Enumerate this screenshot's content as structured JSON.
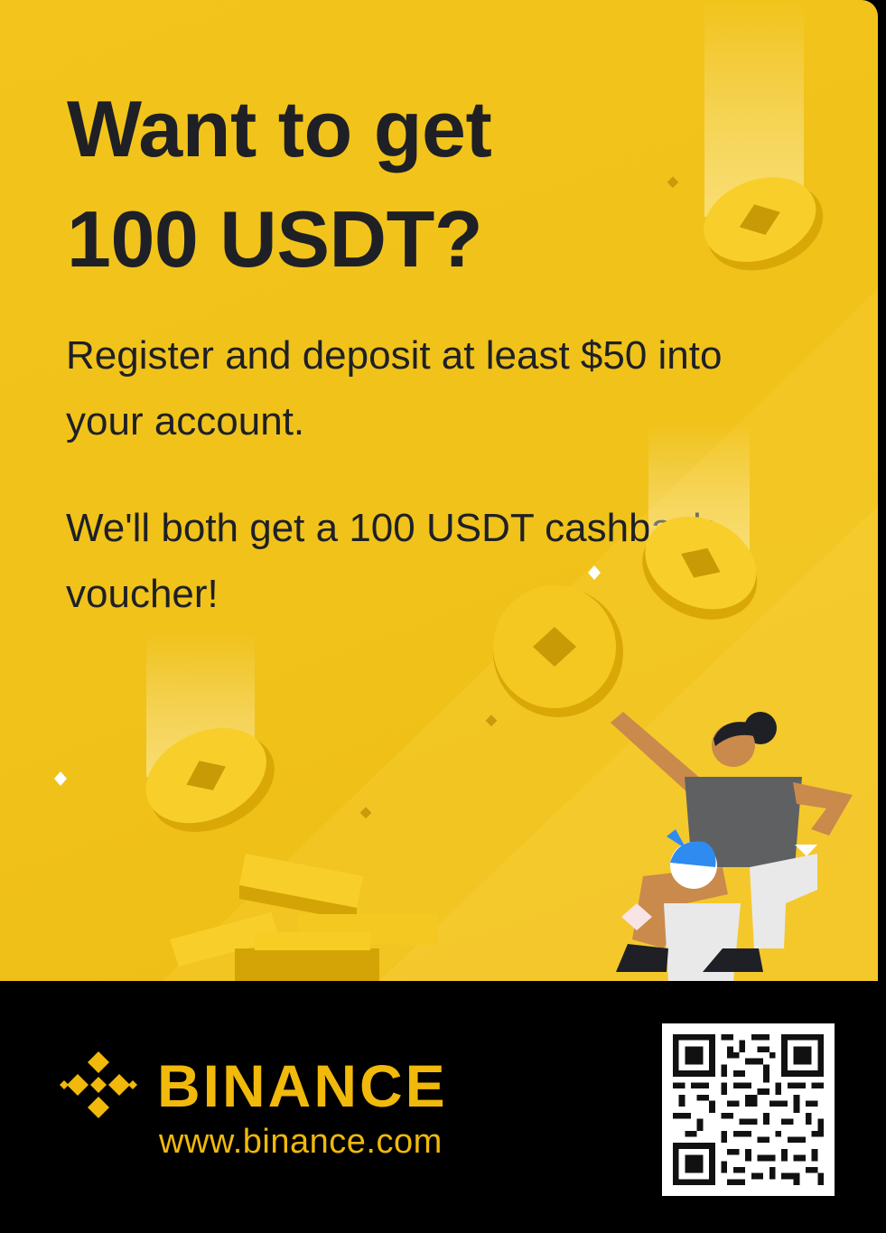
{
  "promo": {
    "headline_line1": "Want to get",
    "headline_line2": "100 USDT?",
    "paragraph1": "Register and deposit at least $50 into your account.",
    "paragraph2": "We'll both get a 100 USDT cashback voucher!"
  },
  "brand": {
    "name": "BINANCE",
    "url": "www.binance.com",
    "logo_icon": "binance-diamond-icon"
  },
  "qr": {
    "icon": "qr-code-icon"
  },
  "colors": {
    "background": "#f0c21a",
    "coin": "#f3c51e",
    "text": "#1e2026",
    "brand": "#f0b90b",
    "footer": "#000000"
  }
}
